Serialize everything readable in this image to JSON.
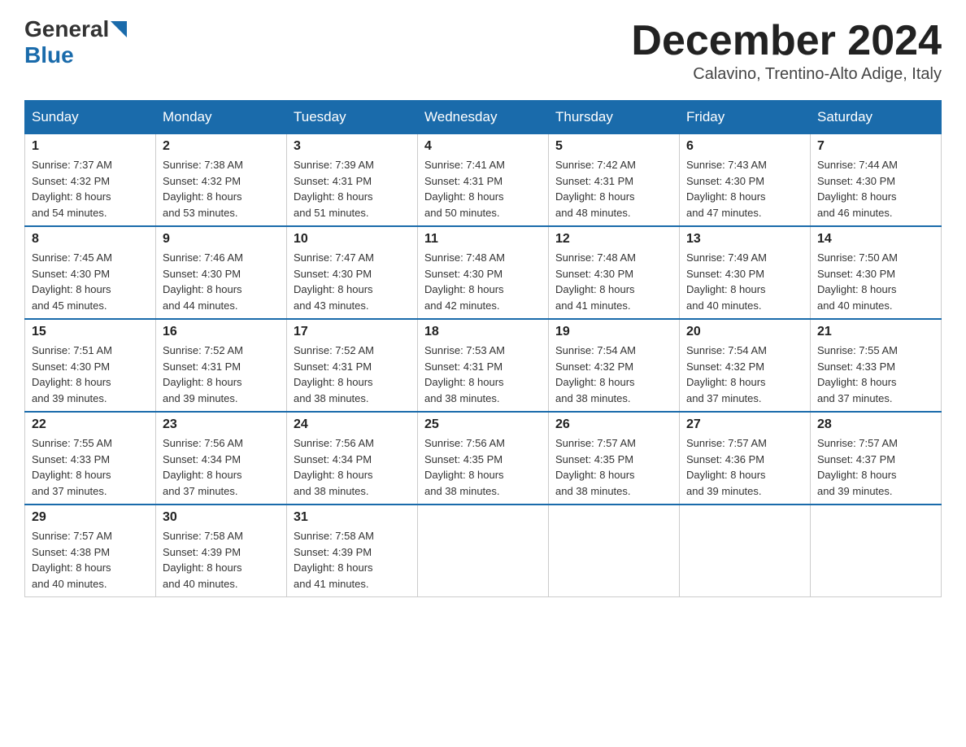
{
  "header": {
    "logo_general": "General",
    "logo_blue": "Blue",
    "month_title": "December 2024",
    "location": "Calavino, Trentino-Alto Adige, Italy"
  },
  "days_of_week": [
    "Sunday",
    "Monday",
    "Tuesday",
    "Wednesday",
    "Thursday",
    "Friday",
    "Saturday"
  ],
  "weeks": [
    {
      "days": [
        {
          "num": "1",
          "sunrise": "7:37 AM",
          "sunset": "4:32 PM",
          "daylight": "8 hours and 54 minutes."
        },
        {
          "num": "2",
          "sunrise": "7:38 AM",
          "sunset": "4:32 PM",
          "daylight": "8 hours and 53 minutes."
        },
        {
          "num": "3",
          "sunrise": "7:39 AM",
          "sunset": "4:31 PM",
          "daylight": "8 hours and 51 minutes."
        },
        {
          "num": "4",
          "sunrise": "7:41 AM",
          "sunset": "4:31 PM",
          "daylight": "8 hours and 50 minutes."
        },
        {
          "num": "5",
          "sunrise": "7:42 AM",
          "sunset": "4:31 PM",
          "daylight": "8 hours and 48 minutes."
        },
        {
          "num": "6",
          "sunrise": "7:43 AM",
          "sunset": "4:30 PM",
          "daylight": "8 hours and 47 minutes."
        },
        {
          "num": "7",
          "sunrise": "7:44 AM",
          "sunset": "4:30 PM",
          "daylight": "8 hours and 46 minutes."
        }
      ]
    },
    {
      "days": [
        {
          "num": "8",
          "sunrise": "7:45 AM",
          "sunset": "4:30 PM",
          "daylight": "8 hours and 45 minutes."
        },
        {
          "num": "9",
          "sunrise": "7:46 AM",
          "sunset": "4:30 PM",
          "daylight": "8 hours and 44 minutes."
        },
        {
          "num": "10",
          "sunrise": "7:47 AM",
          "sunset": "4:30 PM",
          "daylight": "8 hours and 43 minutes."
        },
        {
          "num": "11",
          "sunrise": "7:48 AM",
          "sunset": "4:30 PM",
          "daylight": "8 hours and 42 minutes."
        },
        {
          "num": "12",
          "sunrise": "7:48 AM",
          "sunset": "4:30 PM",
          "daylight": "8 hours and 41 minutes."
        },
        {
          "num": "13",
          "sunrise": "7:49 AM",
          "sunset": "4:30 PM",
          "daylight": "8 hours and 40 minutes."
        },
        {
          "num": "14",
          "sunrise": "7:50 AM",
          "sunset": "4:30 PM",
          "daylight": "8 hours and 40 minutes."
        }
      ]
    },
    {
      "days": [
        {
          "num": "15",
          "sunrise": "7:51 AM",
          "sunset": "4:30 PM",
          "daylight": "8 hours and 39 minutes."
        },
        {
          "num": "16",
          "sunrise": "7:52 AM",
          "sunset": "4:31 PM",
          "daylight": "8 hours and 39 minutes."
        },
        {
          "num": "17",
          "sunrise": "7:52 AM",
          "sunset": "4:31 PM",
          "daylight": "8 hours and 38 minutes."
        },
        {
          "num": "18",
          "sunrise": "7:53 AM",
          "sunset": "4:31 PM",
          "daylight": "8 hours and 38 minutes."
        },
        {
          "num": "19",
          "sunrise": "7:54 AM",
          "sunset": "4:32 PM",
          "daylight": "8 hours and 38 minutes."
        },
        {
          "num": "20",
          "sunrise": "7:54 AM",
          "sunset": "4:32 PM",
          "daylight": "8 hours and 37 minutes."
        },
        {
          "num": "21",
          "sunrise": "7:55 AM",
          "sunset": "4:33 PM",
          "daylight": "8 hours and 37 minutes."
        }
      ]
    },
    {
      "days": [
        {
          "num": "22",
          "sunrise": "7:55 AM",
          "sunset": "4:33 PM",
          "daylight": "8 hours and 37 minutes."
        },
        {
          "num": "23",
          "sunrise": "7:56 AM",
          "sunset": "4:34 PM",
          "daylight": "8 hours and 37 minutes."
        },
        {
          "num": "24",
          "sunrise": "7:56 AM",
          "sunset": "4:34 PM",
          "daylight": "8 hours and 38 minutes."
        },
        {
          "num": "25",
          "sunrise": "7:56 AM",
          "sunset": "4:35 PM",
          "daylight": "8 hours and 38 minutes."
        },
        {
          "num": "26",
          "sunrise": "7:57 AM",
          "sunset": "4:35 PM",
          "daylight": "8 hours and 38 minutes."
        },
        {
          "num": "27",
          "sunrise": "7:57 AM",
          "sunset": "4:36 PM",
          "daylight": "8 hours and 39 minutes."
        },
        {
          "num": "28",
          "sunrise": "7:57 AM",
          "sunset": "4:37 PM",
          "daylight": "8 hours and 39 minutes."
        }
      ]
    },
    {
      "days": [
        {
          "num": "29",
          "sunrise": "7:57 AM",
          "sunset": "4:38 PM",
          "daylight": "8 hours and 40 minutes."
        },
        {
          "num": "30",
          "sunrise": "7:58 AM",
          "sunset": "4:39 PM",
          "daylight": "8 hours and 40 minutes."
        },
        {
          "num": "31",
          "sunrise": "7:58 AM",
          "sunset": "4:39 PM",
          "daylight": "8 hours and 41 minutes."
        },
        null,
        null,
        null,
        null
      ]
    }
  ],
  "labels": {
    "sunrise_prefix": "Sunrise: ",
    "sunset_prefix": "Sunset: ",
    "daylight_prefix": "Daylight: "
  }
}
